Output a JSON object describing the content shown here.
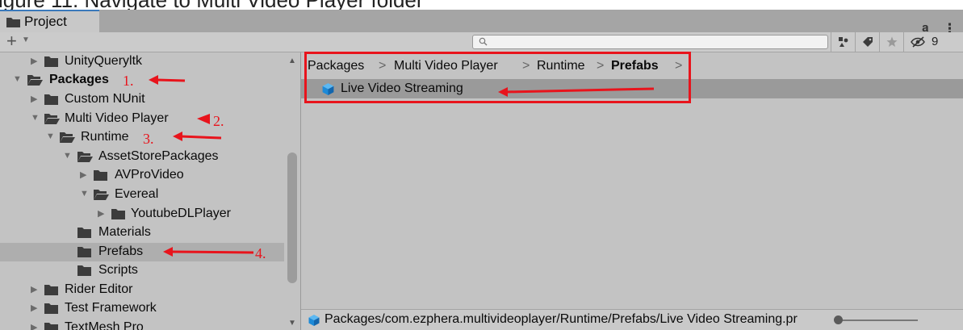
{
  "clipped_caption": "igure 11. Navigate to Multi Video Player folder",
  "window": {
    "tab_label": "Project",
    "lock_icon": "lock-icon",
    "menu_icon": "kebab-menu-icon"
  },
  "toolbar": {
    "create_label": "+",
    "search_value": "",
    "hidden_count": "9"
  },
  "tree": {
    "items": [
      {
        "label": "UnityQueryltk",
        "depth": 1,
        "expanded": false,
        "bold": false
      },
      {
        "label": "Packages",
        "depth": 0,
        "expanded": true,
        "bold": true
      },
      {
        "label": "Custom NUnit",
        "depth": 1,
        "expanded": false,
        "bold": false
      },
      {
        "label": "Multi Video Player",
        "depth": 1,
        "expanded": true,
        "bold": false
      },
      {
        "label": "Runtime",
        "depth": 2,
        "expanded": true,
        "bold": false
      },
      {
        "label": "AssetStorePackages",
        "depth": 3,
        "expanded": true,
        "bold": false
      },
      {
        "label": "AVProVideo",
        "depth": 4,
        "expanded": false,
        "bold": false
      },
      {
        "label": "Evereal",
        "depth": 4,
        "expanded": true,
        "bold": false
      },
      {
        "label": "YoutubeDLPlayer",
        "depth": 5,
        "expanded": false,
        "bold": false
      },
      {
        "label": "Materials",
        "depth": 3,
        "expanded": null,
        "bold": false
      },
      {
        "label": "Prefabs",
        "depth": 3,
        "expanded": null,
        "bold": false,
        "selected": true
      },
      {
        "label": "Scripts",
        "depth": 3,
        "expanded": null,
        "bold": false
      },
      {
        "label": "Rider Editor",
        "depth": 1,
        "expanded": false,
        "bold": false
      },
      {
        "label": "Test Framework",
        "depth": 1,
        "expanded": false,
        "bold": false
      },
      {
        "label": "TextMesh Pro",
        "depth": 1,
        "expanded": false,
        "bold": false
      }
    ]
  },
  "breadcrumb": {
    "items": [
      "Packages",
      "Multi Video Player",
      "Runtime",
      "Prefabs"
    ],
    "separator": ">"
  },
  "assets": [
    {
      "label": "Live Video Streaming",
      "icon": "prefab-cube-icon"
    }
  ],
  "status": {
    "path": "Packages/com.ezphera.multivideoplayer/Runtime/Prefabs/Live Video Streaming.pr"
  },
  "annotations": {
    "labels": [
      "1.",
      "2.",
      "3.",
      "4."
    ],
    "color": "#e8141c"
  },
  "colors": {
    "panel_bg": "#c3c3c3",
    "tab_accent": "#3a79bb",
    "selection": "#aeaeae",
    "asset_selection": "#9a9a9a",
    "prefab_blue": "#1d8ad8"
  }
}
